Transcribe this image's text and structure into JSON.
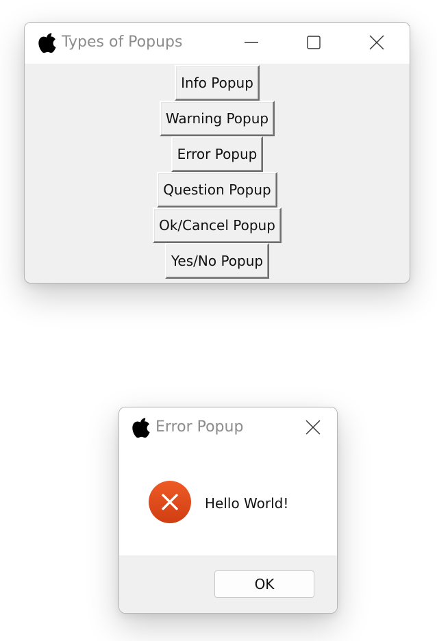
{
  "main_window": {
    "title": "Types of Popups",
    "app_icon": "apple-logo-icon",
    "controls": [
      "minimize-icon",
      "maximize-icon",
      "close-icon"
    ],
    "buttons": [
      {
        "label": "Info Popup"
      },
      {
        "label": "Warning Popup"
      },
      {
        "label": "Error Popup"
      },
      {
        "label": "Question Popup"
      },
      {
        "label": "Ok/Cancel Popup"
      },
      {
        "label": "Yes/No Popup"
      }
    ]
  },
  "error_dialog": {
    "title": "Error Popup",
    "app_icon": "apple-logo-icon",
    "status_icon": "error-icon",
    "message": "Hello World!",
    "ok_label": "OK"
  },
  "colors": {
    "window_background": "#f0f0f0",
    "titlebar_background": "#ffffff",
    "title_text": "#8c8c8c",
    "error_red": "#e0461a"
  }
}
